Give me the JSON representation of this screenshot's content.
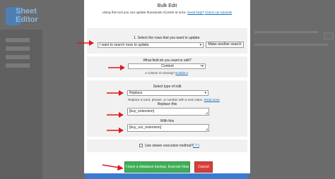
{
  "background": {
    "footer_color": "#3a7bd1"
  },
  "modal": {
    "title": "Bulk Edit",
    "subtitle": "Using this tool you can update thousands of posts at once.",
    "need_help": "Need help?",
    "tutorials": "Check our tutorials",
    "rows_section": {
      "label": "1. Select the rows that you want to update.",
      "select_value": "I want to search rows to update",
      "another_search_button": "Make another search"
    },
    "field_section": {
      "label": "What field do you want to edit?",
      "select_value": "Content",
      "missing_text": "A column is missing?",
      "enable_link": "Enable it"
    },
    "edit_type_section": {
      "label": "Select type of edit",
      "select_value": "Replace",
      "hint": "Replace a word, phrase, or number with a new value.",
      "read_more": "Read more",
      "replace_label": "Replace this",
      "replace_value": "[buy_extension]",
      "with_label": "With this",
      "with_value": "[buy_our_extension]"
    },
    "slower_method": {
      "label": "Use slower execution method?",
      "help": "( ? )"
    },
    "execute_button": "I have a database backup, Execute Now",
    "cancel_button": "Cancel",
    "arrow_color": "#e0161b"
  }
}
